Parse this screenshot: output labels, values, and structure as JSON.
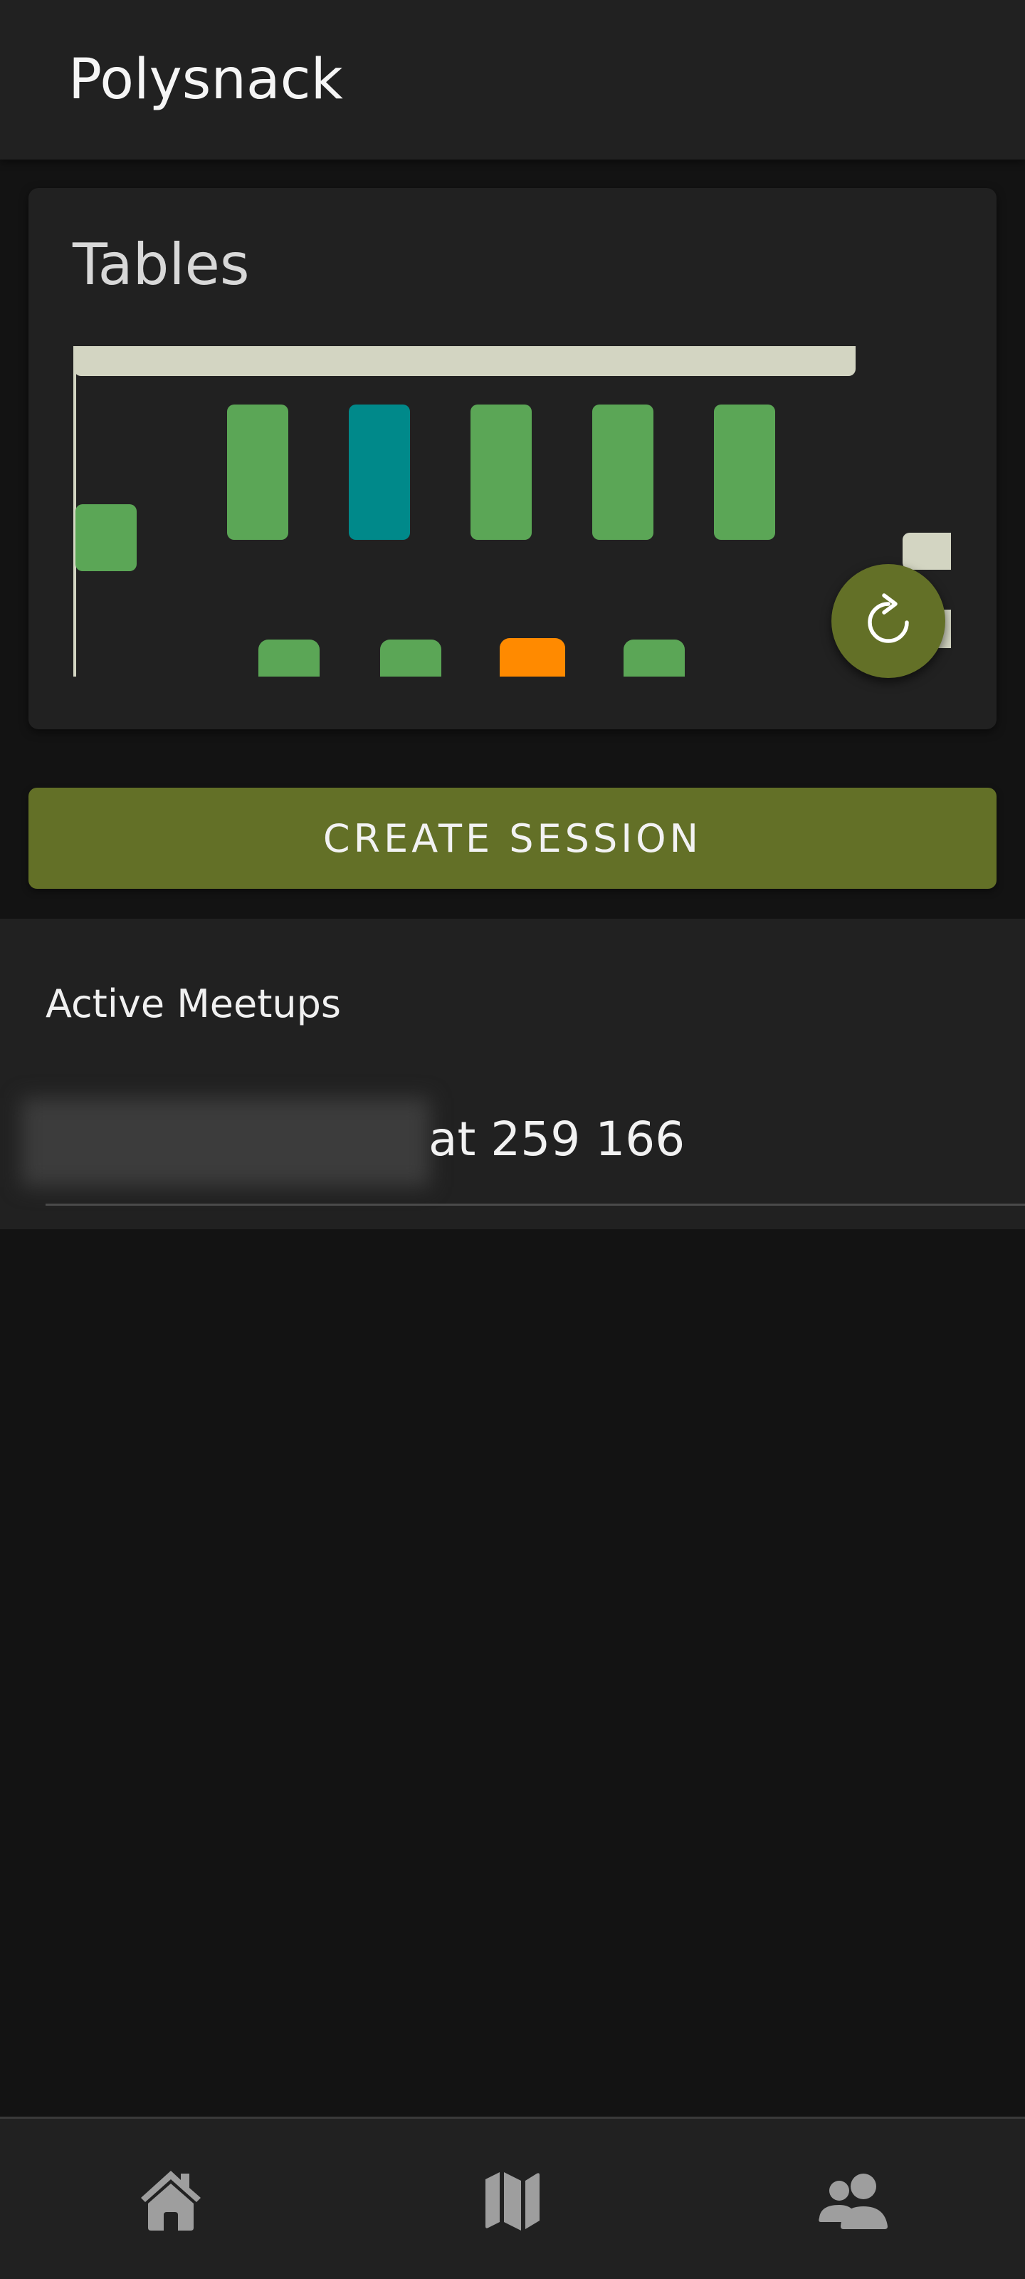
{
  "app": {
    "title": "Polysnack"
  },
  "tables_card": {
    "title": "Tables",
    "colors": {
      "available": "#5ba656",
      "selected": "#00898a",
      "occupied": "#ff8a00",
      "wall": "#d3d5c2"
    },
    "tables": [
      {
        "id": "side-left",
        "status": "available"
      },
      {
        "id": "top-1",
        "status": "available"
      },
      {
        "id": "top-2",
        "status": "selected"
      },
      {
        "id": "top-3",
        "status": "available"
      },
      {
        "id": "top-4",
        "status": "available"
      },
      {
        "id": "top-5",
        "status": "available"
      },
      {
        "id": "low-1",
        "status": "available"
      },
      {
        "id": "low-2",
        "status": "available"
      },
      {
        "id": "low-3",
        "status": "occupied"
      },
      {
        "id": "low-4",
        "status": "available"
      }
    ],
    "refresh_icon": "refresh-icon"
  },
  "actions": {
    "create_session_label": "CREATE SESSION"
  },
  "meetups": {
    "header": "Active Meetups",
    "items": [
      {
        "visible_text": "at 259 166"
      }
    ]
  },
  "bottom_nav": {
    "items": [
      {
        "icon": "home-icon"
      },
      {
        "icon": "map-icon"
      },
      {
        "icon": "people-icon"
      }
    ]
  }
}
